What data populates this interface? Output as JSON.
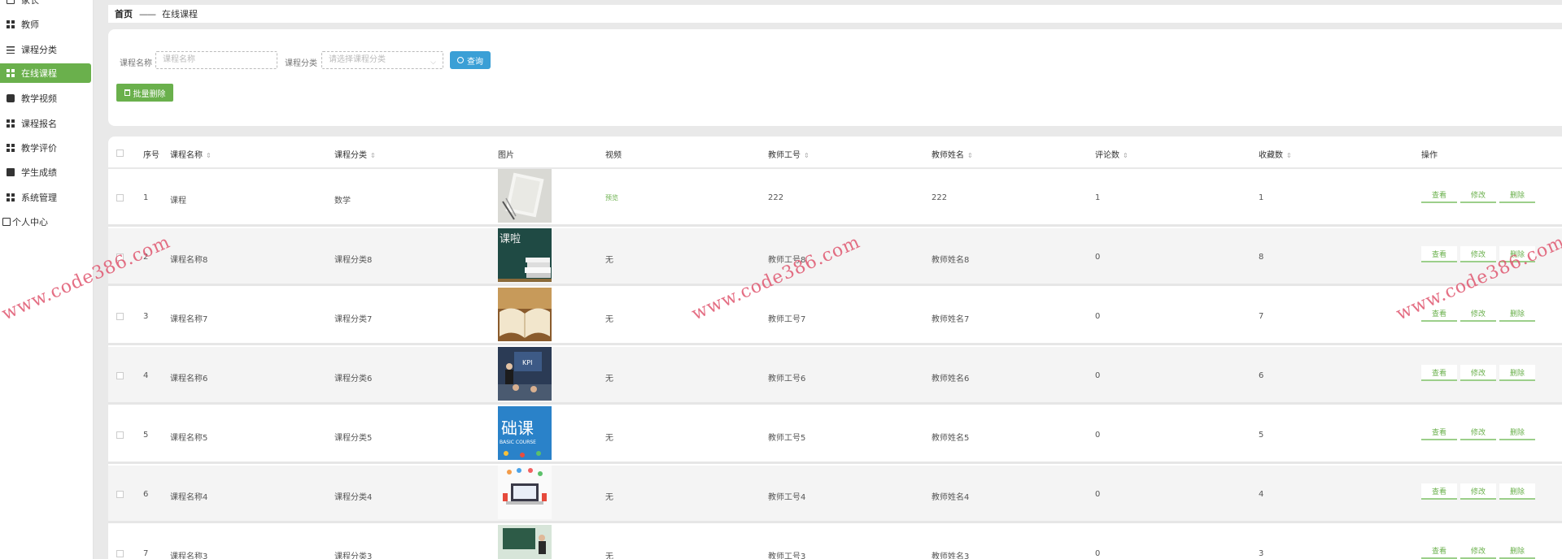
{
  "sidebar": {
    "items": [
      {
        "label": "家长",
        "icon": "doc-icon"
      },
      {
        "label": "教师",
        "icon": "grid-icon"
      },
      {
        "label": "课程分类",
        "icon": "sliders-icon"
      },
      {
        "label": "在线课程",
        "icon": "grid-icon",
        "active": true
      },
      {
        "label": "教学视频",
        "icon": "box-icon"
      },
      {
        "label": "课程报名",
        "icon": "grid-icon"
      },
      {
        "label": "教学评价",
        "icon": "grid-icon"
      },
      {
        "label": "学生成绩",
        "icon": "clipboard-icon"
      },
      {
        "label": "系统管理",
        "icon": "grid-icon"
      },
      {
        "label": "个人中心",
        "icon": "user-card-icon"
      }
    ]
  },
  "breadcrumb": {
    "home": "首页",
    "separator": "——",
    "current": "在线课程"
  },
  "search": {
    "name_label": "课程名称",
    "name_placeholder": "课程名称",
    "category_label": "课程分类",
    "category_placeholder": "请选择课程分类",
    "query_button": "查询",
    "batch_delete_button": "批量删除"
  },
  "table": {
    "headers": {
      "index": "序号",
      "name": "课程名称",
      "category": "课程分类",
      "image": "图片",
      "video": "视频",
      "teacher_no": "教师工号",
      "teacher_name": "教师姓名",
      "comments": "评论数",
      "favorites": "收藏数",
      "actions": "操作"
    },
    "actions": {
      "view": "查看",
      "edit": "修改",
      "delete": "删除"
    },
    "rows": [
      {
        "index": "1",
        "name": "课程",
        "category": "数学",
        "video": "预览",
        "teacher_no": "222",
        "teacher_name": "222",
        "comments": "1",
        "favorites": "1"
      },
      {
        "index": "2",
        "name": "课程名称8",
        "category": "课程分类8",
        "video": "无",
        "teacher_no": "教师工号8",
        "teacher_name": "教师姓名8",
        "comments": "0",
        "favorites": "8"
      },
      {
        "index": "3",
        "name": "课程名称7",
        "category": "课程分类7",
        "video": "无",
        "teacher_no": "教师工号7",
        "teacher_name": "教师姓名7",
        "comments": "0",
        "favorites": "7"
      },
      {
        "index": "4",
        "name": "课程名称6",
        "category": "课程分类6",
        "video": "无",
        "teacher_no": "教师工号6",
        "teacher_name": "教师姓名6",
        "comments": "0",
        "favorites": "6"
      },
      {
        "index": "5",
        "name": "课程名称5",
        "category": "课程分类5",
        "video": "无",
        "teacher_no": "教师工号5",
        "teacher_name": "教师姓名5",
        "comments": "0",
        "favorites": "5"
      },
      {
        "index": "6",
        "name": "课程名称4",
        "category": "课程分类4",
        "video": "无",
        "teacher_no": "教师工号4",
        "teacher_name": "教师姓名4",
        "comments": "0",
        "favorites": "4"
      },
      {
        "index": "7",
        "name": "课程名称3",
        "category": "课程分类3",
        "video": "无",
        "teacher_no": "教师工号3",
        "teacher_name": "教师姓名3",
        "comments": "0",
        "favorites": "3"
      }
    ]
  },
  "thumbnails": {
    "row2_text": "课啦",
    "row4_text": "KPI",
    "row5_text": "础课",
    "row5_sub": "BASIC COURSE"
  },
  "watermark": "www.code386.com",
  "colors": {
    "accent_green": "#6ab04c",
    "query_blue": "#3a9fd6",
    "watermark": "#e0566f"
  }
}
